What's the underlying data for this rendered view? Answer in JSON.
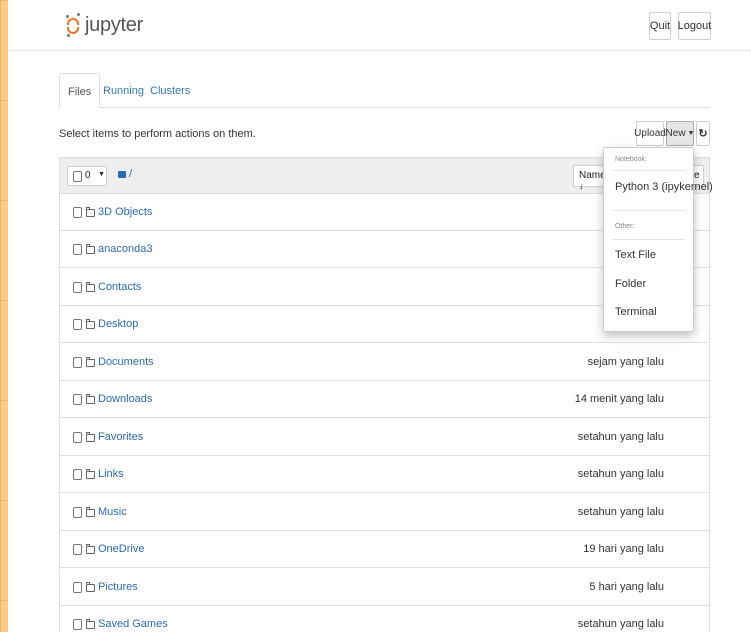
{
  "header": {
    "logo_text": "jupyter",
    "quit_label": "Quit",
    "logout_label": "Logout"
  },
  "tabs": [
    {
      "label": "Files",
      "active": true
    },
    {
      "label": "Running",
      "active": false
    },
    {
      "label": "Clusters",
      "active": false
    }
  ],
  "toolbar": {
    "select_text": "Select items to perform actions on them.",
    "upload_label": "Upload",
    "new_label": "New",
    "refresh_icon": "refresh-icon"
  },
  "list_header": {
    "selected_count": "0",
    "breadcrumb": "/",
    "name_sort_label": "Name",
    "last_modified_label_tail": "e"
  },
  "items": [
    {
      "name": "3D Objects",
      "modified": ""
    },
    {
      "name": "anaconda3",
      "modified": ""
    },
    {
      "name": "Contacts",
      "modified": ""
    },
    {
      "name": "Desktop",
      "modified": ""
    },
    {
      "name": "Documents",
      "modified": "sejam yang lalu"
    },
    {
      "name": "Downloads",
      "modified": "14 menit yang lalu"
    },
    {
      "name": "Favorites",
      "modified": "setahun yang lalu"
    },
    {
      "name": "Links",
      "modified": "setahun yang lalu"
    },
    {
      "name": "Music",
      "modified": "setahun yang lalu"
    },
    {
      "name": "OneDrive",
      "modified": "19 hari yang lalu"
    },
    {
      "name": "Pictures",
      "modified": "5 hari yang lalu"
    },
    {
      "name": "Saved Games",
      "modified": "setahun yang lalu"
    }
  ],
  "new_menu": {
    "notebook_header": "Notebook:",
    "python_kernel": "Python 3 (ipykernel)",
    "other_header": "Other:",
    "text_file": "Text File",
    "folder": "Folder",
    "terminal": "Terminal"
  },
  "colors": {
    "accent_orange": "#f37626",
    "link_blue": "#2a6bb3",
    "background_outer": "#f8cc84"
  }
}
